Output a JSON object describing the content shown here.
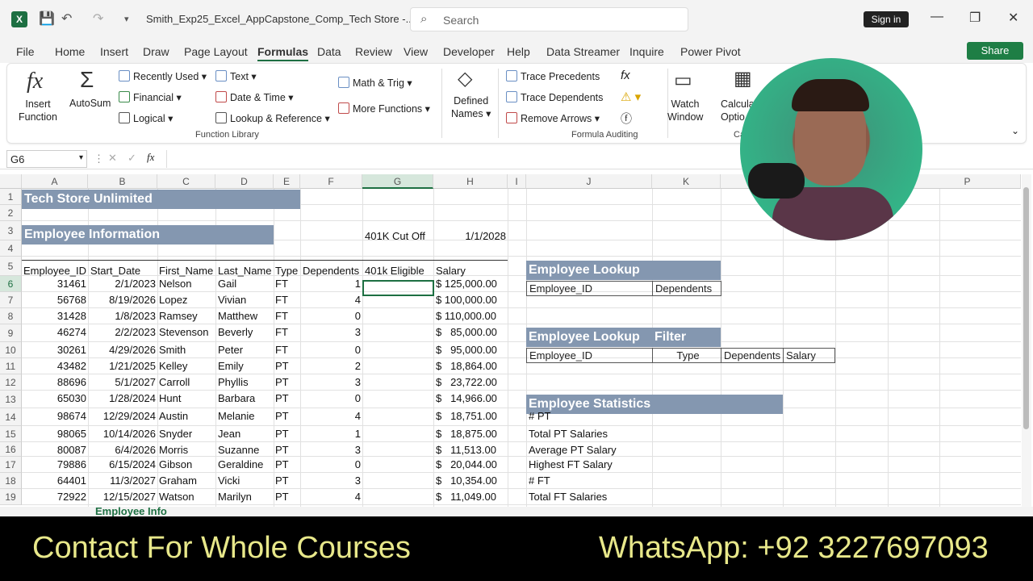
{
  "titlebar": {
    "doc_title": "Smith_Exp25_Excel_AppCapstone_Comp_Tech Store -...",
    "search_placeholder": "Search",
    "sign_in": "Sign in"
  },
  "tabs": [
    "File",
    "Home",
    "Insert",
    "Draw",
    "Page Layout",
    "Formulas",
    "Data",
    "Review",
    "View",
    "Developer",
    "Help",
    "Data Streamer",
    "Inquire",
    "Power Pivot"
  ],
  "share": "Share",
  "ribbon": {
    "insert_function": [
      "Insert",
      "Function"
    ],
    "autosum": "AutoSum",
    "recently_used": "Recently Used",
    "financial": "Financial",
    "logical": "Logical",
    "text": "Text",
    "date_time": "Date & Time",
    "lookup": "Lookup & Reference",
    "math": "Math & Trig",
    "more": "More Functions",
    "function_library": "Function Library",
    "defined_names": [
      "Defined",
      "Names"
    ],
    "trace_precedents": "Trace Precedents",
    "trace_dependents": "Trace Dependents",
    "remove_arrows": "Remove Arrows",
    "formula_auditing": "Formula Auditing",
    "watch": [
      "Watch",
      "Window"
    ],
    "calc": [
      "Calculati",
      "Optio"
    ],
    "calc_grp": "Ca"
  },
  "namebox": "G6",
  "columns": [
    "A",
    "B",
    "C",
    "D",
    "E",
    "F",
    "G",
    "H",
    "I",
    "J",
    "K",
    "P"
  ],
  "rows": [
    "1",
    "2",
    "3",
    "4",
    "5",
    "6",
    "7",
    "8",
    "9",
    "10",
    "11",
    "12",
    "13",
    "14",
    "15",
    "16",
    "17",
    "18",
    "19"
  ],
  "sheet": {
    "title": "Tech Store Unlimited",
    "section": "Employee Information",
    "cutoff_label": "401K Cut Off",
    "cutoff_date": "1/1/2028",
    "headers": [
      "Employee_ID",
      "Start_Date",
      "First_Name",
      "Last_Name",
      "Type",
      "Dependents",
      "401k Eligible",
      "Salary"
    ],
    "data": [
      [
        "31461",
        "2/1/2023",
        "Nelson",
        "Gail",
        "FT",
        "1",
        "$ 125,000.00"
      ],
      [
        "56768",
        "8/19/2026",
        "Lopez",
        "Vivian",
        "FT",
        "4",
        "$ 100,000.00"
      ],
      [
        "31428",
        "1/8/2023",
        "Ramsey",
        "Matthew",
        "FT",
        "0",
        "$ 110,000.00"
      ],
      [
        "46274",
        "2/2/2023",
        "Stevenson",
        "Beverly",
        "FT",
        "3",
        "$   85,000.00"
      ],
      [
        "30261",
        "4/29/2026",
        "Smith",
        "Peter",
        "FT",
        "0",
        "$   95,000.00"
      ],
      [
        "43482",
        "1/21/2025",
        "Kelley",
        "Emily",
        "PT",
        "2",
        "$   18,864.00"
      ],
      [
        "88696",
        "5/1/2027",
        "Carroll",
        "Phyllis",
        "PT",
        "3",
        "$   23,722.00"
      ],
      [
        "65030",
        "1/28/2024",
        "Hunt",
        "Barbara",
        "PT",
        "0",
        "$   14,966.00"
      ],
      [
        "98674",
        "12/29/2024",
        "Austin",
        "Melanie",
        "PT",
        "4",
        "$   18,751.00"
      ],
      [
        "98065",
        "10/14/2026",
        "Snyder",
        "Jean",
        "PT",
        "1",
        "$   18,875.00"
      ],
      [
        "80087",
        "6/4/2026",
        "Morris",
        "Suzanne",
        "PT",
        "3",
        "$   11,513.00"
      ],
      [
        "79886",
        "6/15/2024",
        "Gibson",
        "Geraldine",
        "PT",
        "0",
        "$   20,044.00"
      ],
      [
        "64401",
        "11/3/2027",
        "Graham",
        "Vicki",
        "PT",
        "3",
        "$   10,354.00"
      ],
      [
        "72922",
        "12/15/2027",
        "Watson",
        "Marilyn",
        "PT",
        "4",
        "$   11,049.00"
      ]
    ],
    "lookup1": "Employee Lookup",
    "lookup1_cols": [
      "Employee_ID",
      "Dependents"
    ],
    "lookup2": "Employee Lookup",
    "lookup2_filter": "Filter",
    "lookup2_cols": [
      "Employee_ID",
      "Type",
      "Dependents",
      "Salary"
    ],
    "stats": "Employee Statistics",
    "stats_items": [
      "# PT",
      "Total PT Salaries",
      "Average PT Salary",
      "Highest FT Salary",
      "# FT",
      "Total FT Salaries"
    ]
  },
  "sheet_tab": "Employee Info",
  "banner": {
    "left": "Contact For Whole Courses",
    "right": "WhatsApp:  +92 3227697093"
  }
}
